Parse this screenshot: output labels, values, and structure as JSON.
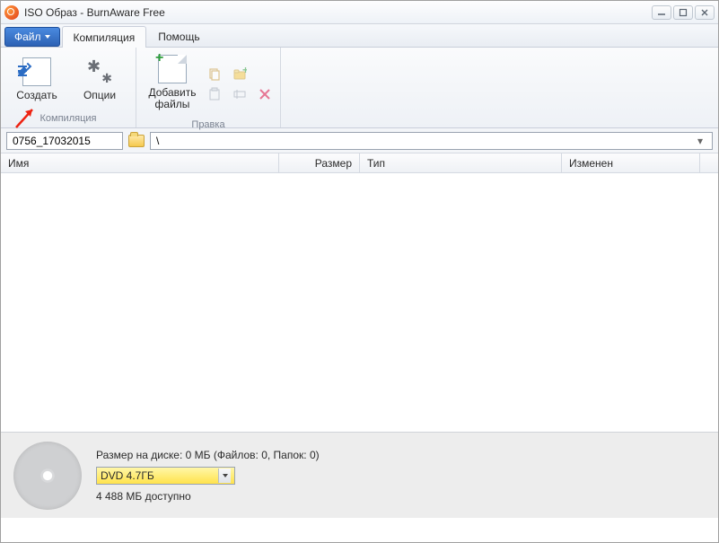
{
  "window": {
    "title": "ISO Образ - BurnAware Free"
  },
  "menu": {
    "file": "Файл",
    "tabs": [
      {
        "label": "Компиляция",
        "active": true
      },
      {
        "label": "Помощь",
        "active": false
      }
    ]
  },
  "ribbon": {
    "groups": {
      "compilation": {
        "label": "Компиляция",
        "burn": "Создать",
        "options": "Опции"
      },
      "edit": {
        "label": "Правка",
        "addfiles": "Добавить файлы"
      }
    }
  },
  "path": {
    "project_name": "0756_17032015",
    "current": "\\"
  },
  "columns": {
    "name": "Имя",
    "size": "Размер",
    "type": "Тип",
    "modified": "Изменен"
  },
  "status": {
    "summary": "Размер на диске: 0 МБ (Файлов: 0, Папок: 0)",
    "disc_type": "DVD 4.7ГБ",
    "available": "4 488 МБ доступно"
  }
}
